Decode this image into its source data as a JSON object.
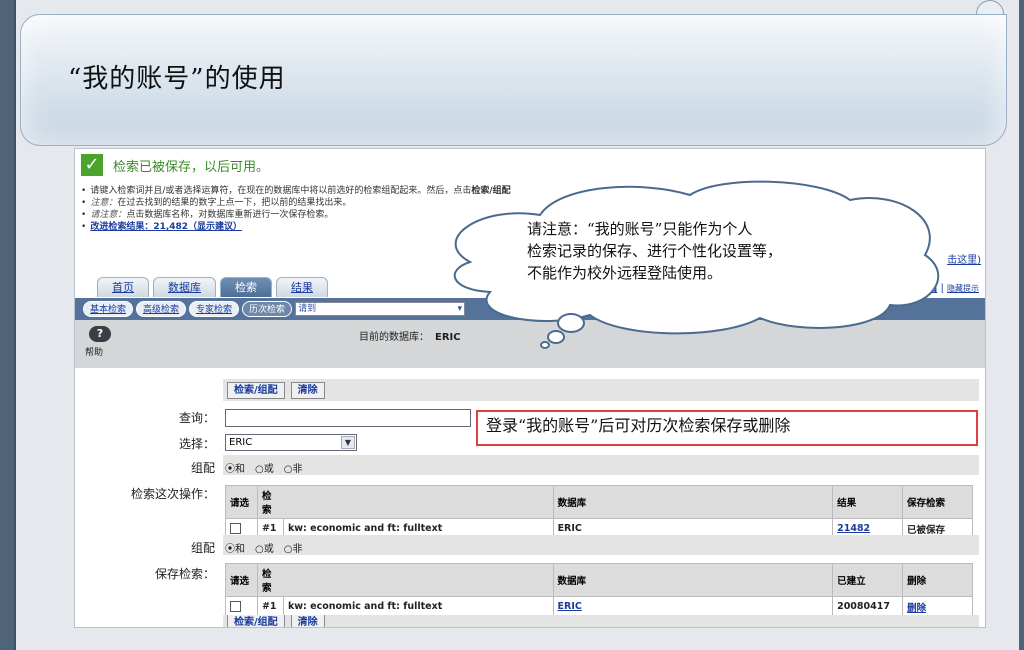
{
  "slide": {
    "title": "“我的账号”的使用"
  },
  "status": {
    "saved_text": "检索已被保存，以后可用。"
  },
  "tips": {
    "line1a": "请键入检索词并且/或者选择运算符，在现在的数据库中将以前选好的检索组配起来。然后，点击",
    "line1b": "检索/组配",
    "line2_label": "注意：",
    "line2": "在过去找到的结果的数字上点一下，把以前的结果找出来。",
    "line3_label": "请注意：",
    "line3": "点击数据库名称，对数据库重新进行一次保存检索。",
    "advance": "改进检索结果：21,482（显示建议）"
  },
  "nav": {
    "tabs": [
      "首页",
      "数据库",
      "检索",
      "结果"
    ],
    "click_here": "击这里)",
    "logout": "退出",
    "hide_tips": "隐藏提示"
  },
  "subtabs": {
    "basic": "基本检索",
    "advanced": "高级检索",
    "expert": "专家检索",
    "history": "历次检索",
    "goto": "请到"
  },
  "info": {
    "help_label": "帮助",
    "help_icon": "?",
    "current_db_label": "目前的数据库：",
    "current_db": "ERIC"
  },
  "form": {
    "search_btn": "检索/组配",
    "clear_btn": "清除",
    "query_label": "查询：",
    "select_label": "选择：",
    "select_value": "ERIC",
    "combine_label": "组配",
    "this_session_label": "检索这次操作：",
    "saved_label": "保存检索：",
    "radio_and": "和",
    "radio_or": "或",
    "radio_not": "非"
  },
  "session_table": {
    "headers": [
      "请选",
      "检索",
      "",
      "数据库",
      "结果",
      "保存检索"
    ],
    "row": {
      "num": "#1",
      "query": "kw: economic and ft: fulltext",
      "db": "ERIC",
      "results": "21482",
      "status": "已被保存"
    }
  },
  "saved_table": {
    "headers": [
      "请选",
      "检索",
      "",
      "数据库",
      "已建立",
      "删除"
    ],
    "row": {
      "num": "#1",
      "query": "kw: economic and ft: fulltext",
      "db": "ERIC",
      "date": "20080417",
      "action": "删除"
    }
  },
  "callout": {
    "line1": "请注意：“我的账号”只能作为个人",
    "line2": "检索记录的保存、进行个性化设置等，",
    "line3": "不能作为校外远程登陆使用。"
  },
  "annotation": "登录“我的账号”后可对历次检索保存或删除"
}
